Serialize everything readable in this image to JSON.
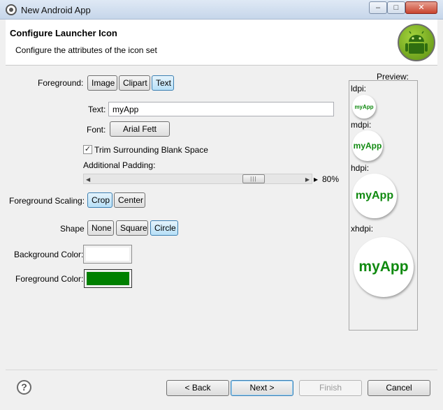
{
  "window": {
    "title": "New Android App",
    "minimize": "–",
    "maximize": "□",
    "close": "✕"
  },
  "header": {
    "title": "Configure Launcher Icon",
    "subtitle": "Configure the attributes of the icon set"
  },
  "foreground": {
    "label": "Foreground:",
    "options": [
      "Image",
      "Clipart",
      "Text"
    ],
    "selected": "Text"
  },
  "text_field": {
    "label": "Text:",
    "value": "myApp"
  },
  "font": {
    "label": "Font:",
    "value": "Arial Fett"
  },
  "trim": {
    "label": "Trim Surrounding Blank Space",
    "checked": true,
    "mark": "✓"
  },
  "padding": {
    "label": "Additional Padding:",
    "value_text": "80%",
    "value": 0.8,
    "thumb_grip": "|||"
  },
  "scaling": {
    "label": "Foreground Scaling:",
    "options": [
      "Crop",
      "Center"
    ],
    "selected": "Crop"
  },
  "shape": {
    "label": "Shape",
    "options": [
      "None",
      "Square",
      "Circle"
    ],
    "selected": "Circle"
  },
  "background_color": {
    "label": "Background Color:",
    "color": "#ffffff"
  },
  "foreground_color": {
    "label": "Foreground Color:",
    "color": "#008000"
  },
  "preview": {
    "title": "Preview:",
    "icon_text": "myApp",
    "text_color": "#108a10",
    "densities": [
      "ldpi:",
      "mdpi:",
      "hdpi:",
      "xhdpi:"
    ]
  },
  "footer": {
    "help": "?",
    "back": "< Back",
    "next": "Next >",
    "finish": "Finish",
    "cancel": "Cancel"
  }
}
